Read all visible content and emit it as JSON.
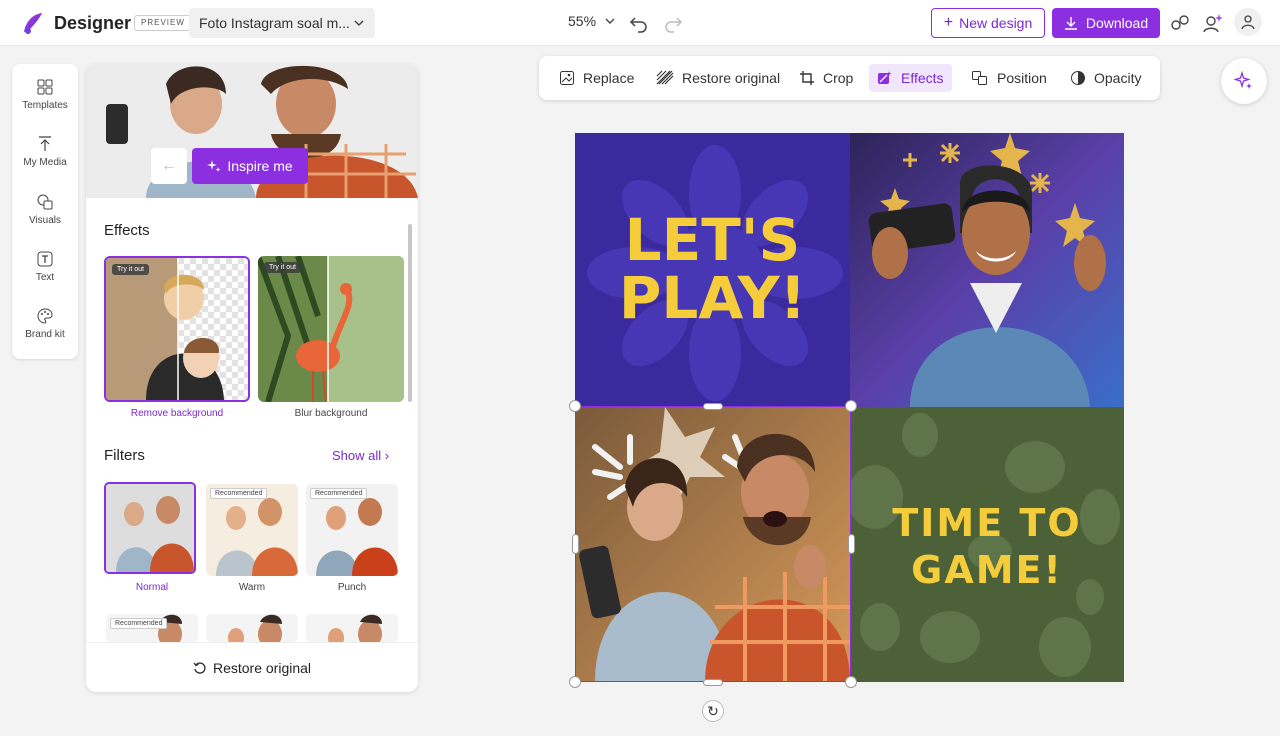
{
  "app": {
    "brand": "Designer",
    "badge": "PREVIEW",
    "doc_name": "Foto Instagram soal m...",
    "zoom": "55%",
    "new_design": "New design",
    "download": "Download",
    "accent": "#8c2fe0"
  },
  "rail": [
    {
      "label": "Templates",
      "icon": "templates-icon"
    },
    {
      "label": "My Media",
      "icon": "upload-icon"
    },
    {
      "label": "Visuals",
      "icon": "visuals-icon"
    },
    {
      "label": "Text",
      "icon": "text-icon"
    },
    {
      "label": "Brand kit",
      "icon": "brand-kit-icon"
    }
  ],
  "panel": {
    "inspire": "Inspire me",
    "effects_title": "Effects",
    "effects": [
      {
        "label": "Remove background",
        "badge": "Try it out",
        "selected": true
      },
      {
        "label": "Blur background",
        "badge": "Try it out",
        "selected": false
      }
    ],
    "filters_title": "Filters",
    "show_all": "Show all",
    "filters": [
      {
        "label": "Normal",
        "badge": "",
        "selected": true
      },
      {
        "label": "Warm",
        "badge": "Recommended",
        "selected": false
      },
      {
        "label": "Punch",
        "badge": "Recommended",
        "selected": false
      }
    ],
    "filters_row2_badge": "Recommended",
    "restore": "Restore original"
  },
  "toolbar": {
    "replace": "Replace",
    "restore": "Restore original",
    "crop": "Crop",
    "effects": "Effects",
    "position": "Position",
    "opacity": "Opacity"
  },
  "canvas": {
    "q1_line1": "LET'S",
    "q1_line2": "PLAY!",
    "q4_line1": "TIME TO",
    "q4_line2": "GAME!",
    "text_color": "#f5cd3b"
  }
}
